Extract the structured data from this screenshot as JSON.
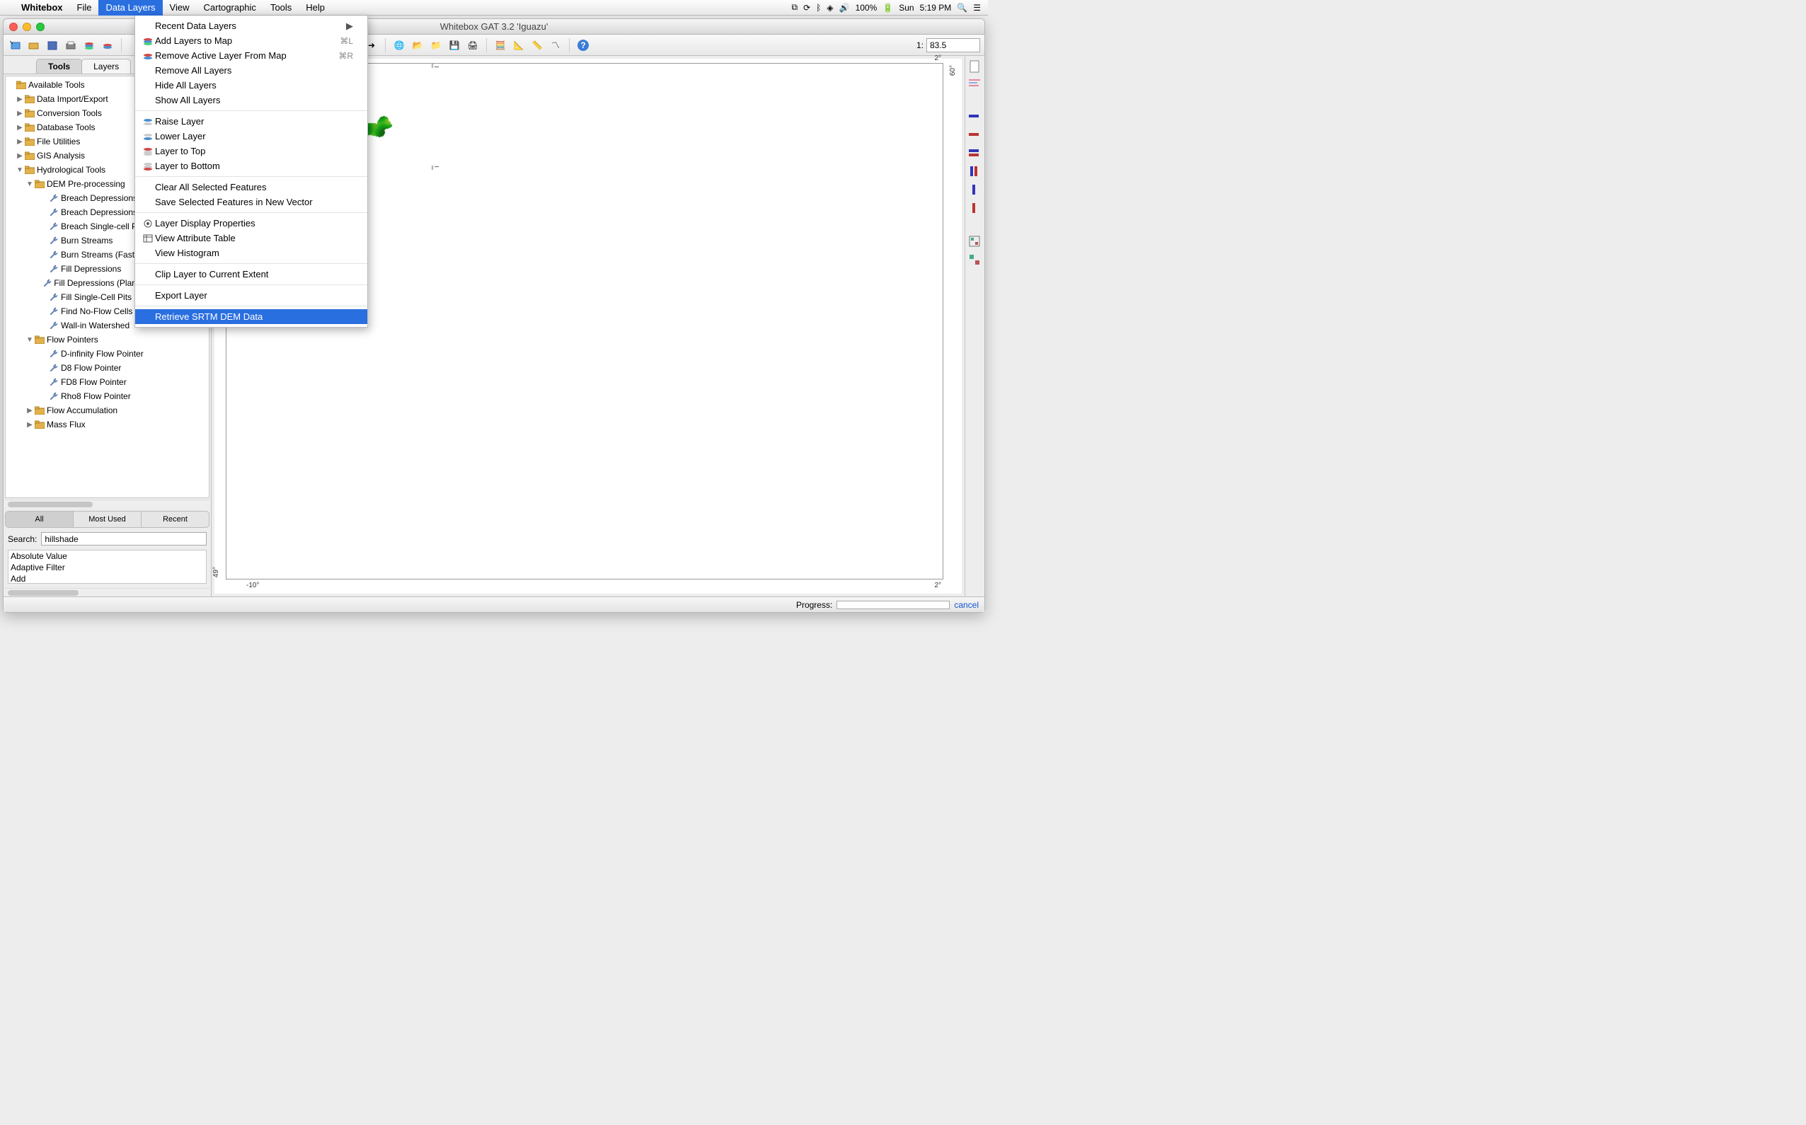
{
  "macbar": {
    "app": "Whitebox",
    "items": [
      "File",
      "Data Layers",
      "View",
      "Cartographic",
      "Tools",
      "Help"
    ],
    "selected": "Data Layers",
    "right": {
      "battery": "100%",
      "day": "Sun",
      "time": "5:19 PM"
    }
  },
  "menu": {
    "g1": [
      {
        "label": "Recent Data Layers",
        "submenu": true
      },
      {
        "label": "Add Layers to Map",
        "icon": "layers-add",
        "shortcut": "⌘L"
      },
      {
        "label": "Remove Active Layer From Map",
        "icon": "layers-remove",
        "shortcut": "⌘R"
      },
      {
        "label": "Remove All Layers"
      },
      {
        "label": "Hide All Layers"
      },
      {
        "label": "Show All Layers"
      }
    ],
    "g2": [
      {
        "label": "Raise Layer",
        "icon": "layer-up"
      },
      {
        "label": "Lower Layer",
        "icon": "layer-down"
      },
      {
        "label": "Layer to Top",
        "icon": "layer-top"
      },
      {
        "label": "Layer to Bottom",
        "icon": "layer-bottom"
      }
    ],
    "g3": [
      {
        "label": "Clear All Selected Features"
      },
      {
        "label": "Save Selected Features in New Vector"
      }
    ],
    "g4": [
      {
        "label": "Layer Display Properties",
        "icon": "props"
      },
      {
        "label": "View Attribute Table",
        "icon": "table"
      },
      {
        "label": "View Histogram"
      }
    ],
    "g5": [
      {
        "label": "Clip Layer to Current Extent"
      }
    ],
    "g6": [
      {
        "label": "Export Layer"
      }
    ],
    "g7": [
      {
        "label": "Retrieve SRTM DEM Data",
        "selected": true
      }
    ]
  },
  "window": {
    "title": "Whitebox GAT 3.2 'Iguazu'",
    "scale_prefix": "1:",
    "scale_value": "83.5"
  },
  "left": {
    "tabs": [
      "Tools",
      "Layers"
    ],
    "active_tab": "Tools",
    "tree": {
      "root": "Available Tools",
      "items": [
        {
          "l": 1,
          "t": "folder",
          "label": "Data Import/Export",
          "collapsed": true
        },
        {
          "l": 1,
          "t": "folder",
          "label": "Conversion Tools",
          "collapsed": true
        },
        {
          "l": 1,
          "t": "folder",
          "label": "Database Tools",
          "collapsed": true
        },
        {
          "l": 1,
          "t": "folder",
          "label": "File Utilities",
          "collapsed": true
        },
        {
          "l": 1,
          "t": "folder",
          "label": "GIS Analysis",
          "collapsed": true
        },
        {
          "l": 1,
          "t": "folder",
          "label": "Hydrological Tools",
          "collapsed": false
        },
        {
          "l": 2,
          "t": "folder",
          "label": "DEM Pre-processing",
          "collapsed": false
        },
        {
          "l": 3,
          "t": "tool",
          "label": "Breach Depressions"
        },
        {
          "l": 3,
          "t": "tool",
          "label": "Breach Depressions (Fast)"
        },
        {
          "l": 3,
          "t": "tool",
          "label": "Breach Single-cell Pits"
        },
        {
          "l": 3,
          "t": "tool",
          "label": "Burn Streams"
        },
        {
          "l": 3,
          "t": "tool",
          "label": "Burn Streams (Fast)"
        },
        {
          "l": 3,
          "t": "tool",
          "label": "Fill Depressions"
        },
        {
          "l": 3,
          "t": "tool",
          "label": "Fill Depressions (Planchon and Darboux)"
        },
        {
          "l": 3,
          "t": "tool",
          "label": "Fill Single-Cell Pits"
        },
        {
          "l": 3,
          "t": "tool",
          "label": "Find No-Flow Cells"
        },
        {
          "l": 3,
          "t": "tool",
          "label": "Wall-in Watershed"
        },
        {
          "l": 2,
          "t": "folder",
          "label": "Flow Pointers",
          "collapsed": false
        },
        {
          "l": 3,
          "t": "tool",
          "label": "D-infinity Flow Pointer"
        },
        {
          "l": 3,
          "t": "tool",
          "label": "D8 Flow Pointer"
        },
        {
          "l": 3,
          "t": "tool",
          "label": "FD8 Flow Pointer"
        },
        {
          "l": 3,
          "t": "tool",
          "label": "Rho8 Flow Pointer"
        },
        {
          "l": 2,
          "t": "folder",
          "label": "Flow Accumulation",
          "collapsed": true
        },
        {
          "l": 2,
          "t": "folder",
          "label": "Mass Flux",
          "collapsed": true
        }
      ]
    },
    "filters": [
      "All",
      "Most Used",
      "Recent"
    ],
    "filter_active": "All",
    "search_label": "Search:",
    "search_value": "hillshade",
    "results": [
      "Absolute Value",
      "Adaptive Filter",
      "Add"
    ]
  },
  "map": {
    "top_right_lon": "2°",
    "right_top_lat": "60°",
    "left_bottom_lat": "49°",
    "bottom_left_lon": "-10°",
    "bottom_right_lon": "2°"
  },
  "status": {
    "progress_label": "Progress:",
    "cancel": "cancel"
  }
}
